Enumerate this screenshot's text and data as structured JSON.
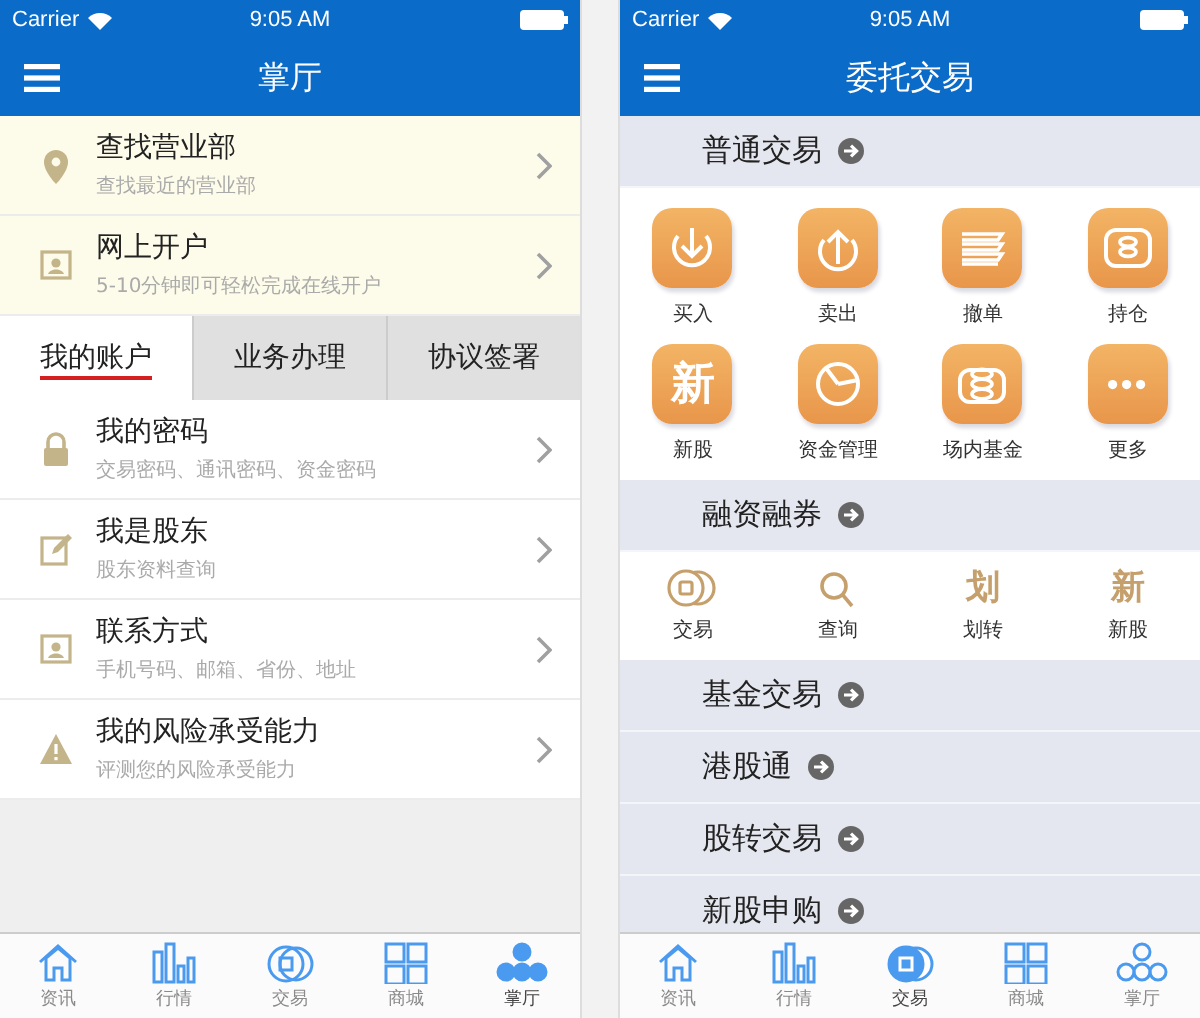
{
  "screens": [
    {
      "kind": "hall",
      "status_bar": {
        "carrier": "Carrier",
        "time": "9:05 AM"
      },
      "title": "掌厅",
      "promo_rows": [
        {
          "title": "查找营业部",
          "subtitle": "查找最近的营业部"
        },
        {
          "title": "网上开户",
          "subtitle": "5-10分钟即可轻松完成在线开户"
        }
      ],
      "tabs": [
        {
          "label": "我的账户",
          "selected": true
        },
        {
          "label": "业务办理",
          "selected": false
        },
        {
          "label": "协议签署",
          "selected": false
        }
      ],
      "rows": [
        {
          "title": "我的密码",
          "subtitle": "交易密码、通讯密码、资金密码"
        },
        {
          "title": "我是股东",
          "subtitle": "股东资料查询"
        },
        {
          "title": "联系方式",
          "subtitle": "手机号码、邮箱、省份、地址"
        },
        {
          "title": "我的风险承受能力",
          "subtitle": "评测您的风险承受能力"
        }
      ],
      "tab_bar": [
        {
          "label": "资讯",
          "selected": false
        },
        {
          "label": "行情",
          "selected": false
        },
        {
          "label": "交易",
          "selected": false
        },
        {
          "label": "商城",
          "selected": false
        },
        {
          "label": "掌厅",
          "selected": true
        }
      ]
    },
    {
      "kind": "trade",
      "status_bar": {
        "carrier": "Carrier",
        "time": "9:05 AM"
      },
      "title": "委托交易",
      "sections": [
        {
          "title": "普通交易",
          "kind": "grid",
          "items": [
            {
              "label": "买入"
            },
            {
              "label": "卖出"
            },
            {
              "label": "撤单"
            },
            {
              "label": "持仓"
            },
            {
              "label": "新股",
              "glyph": "新"
            },
            {
              "label": "资金管理"
            },
            {
              "label": "场内基金"
            },
            {
              "label": "更多"
            }
          ]
        },
        {
          "title": "融资融券",
          "kind": "strip",
          "items": [
            {
              "label": "交易"
            },
            {
              "label": "查询"
            },
            {
              "label": "划转",
              "glyph": "划"
            },
            {
              "label": "新股",
              "glyph": "新"
            }
          ]
        },
        {
          "title": "基金交易",
          "kind": "header"
        },
        {
          "title": "港股通",
          "kind": "header"
        },
        {
          "title": "股转交易",
          "kind": "header"
        },
        {
          "title": "新股申购",
          "kind": "header"
        }
      ],
      "tab_bar": [
        {
          "label": "资讯",
          "selected": false
        },
        {
          "label": "行情",
          "selected": false
        },
        {
          "label": "交易",
          "selected": true
        },
        {
          "label": "商城",
          "selected": false
        },
        {
          "label": "掌厅",
          "selected": false
        }
      ]
    }
  ]
}
